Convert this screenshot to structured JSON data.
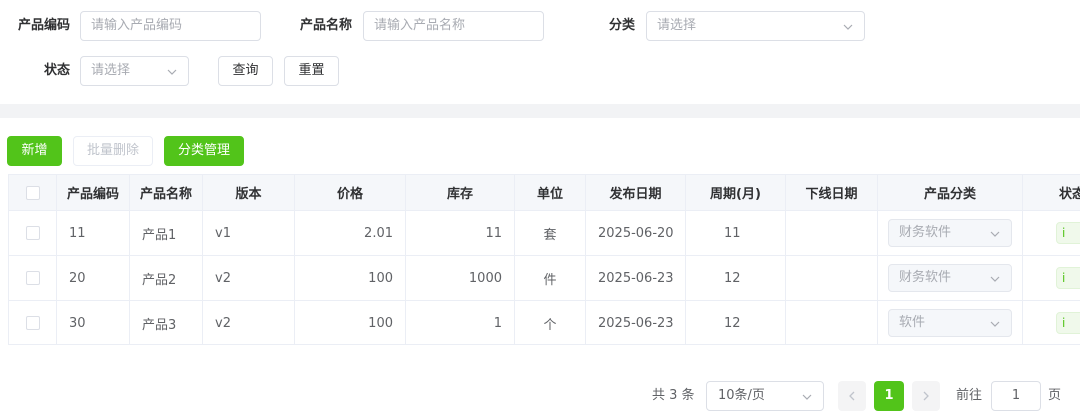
{
  "search": {
    "code_label": "产品编码",
    "code_placeholder": "请输入产品编码",
    "name_label": "产品名称",
    "name_placeholder": "请输入产品名称",
    "category_label": "分类",
    "category_placeholder": "请选择",
    "status_label": "状态",
    "status_placeholder": "请选择",
    "query_label": "查询",
    "reset_label": "重置"
  },
  "toolbar": {
    "add_label": "新增",
    "batch_delete_label": "批量删除",
    "category_manage_label": "分类管理"
  },
  "table": {
    "headers": [
      "产品编码",
      "产品名称",
      "版本",
      "价格",
      "库存",
      "单位",
      "发布日期",
      "周期(月)",
      "下线日期",
      "产品分类",
      "状态"
    ],
    "rows": [
      {
        "code": "11",
        "name": "产品1",
        "version": "v1",
        "price": "2.01",
        "stock": "11",
        "unit": "套",
        "release": "2025-06-20",
        "period": "11",
        "offline": "",
        "category": "财务软件",
        "status_tag": "i"
      },
      {
        "code": "20",
        "name": "产品2",
        "version": "v2",
        "price": "100",
        "stock": "1000",
        "unit": "件",
        "release": "2025-06-23",
        "period": "12",
        "offline": "",
        "category": "财务软件",
        "status_tag": "i"
      },
      {
        "code": "30",
        "name": "产品3",
        "version": "v2",
        "price": "100",
        "stock": "1",
        "unit": "个",
        "release": "2025-06-23",
        "period": "12",
        "offline": "",
        "category": "软件",
        "status_tag": "i"
      }
    ]
  },
  "pagination": {
    "total_text": "共 3 条",
    "page_size": "10条/页",
    "current_page": "1",
    "goto_label": "前往",
    "goto_value": "1",
    "page_suffix": "页"
  },
  "colors": {
    "accent": "#52c41a",
    "border": "#dcdfe6",
    "header_bg": "#f5f7fa"
  }
}
